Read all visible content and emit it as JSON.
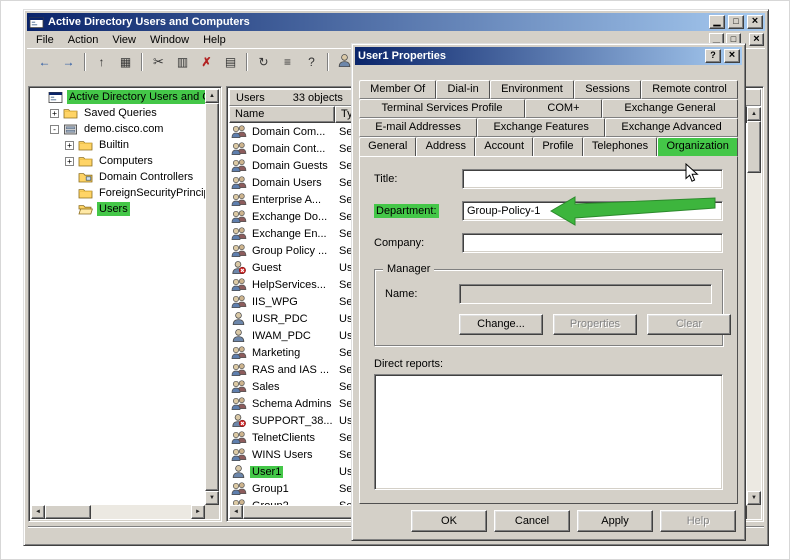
{
  "colors": {
    "titlebar_start": "#0a246a",
    "titlebar_end": "#a6caf0",
    "chrome": "#d4d0c8",
    "highlight": "#44c748",
    "annotation_green": "#3db53d"
  },
  "glyphs": {
    "minimize": "▁",
    "maximize": "□",
    "close": "×",
    "help": "?",
    "scroll_up": "▲",
    "scroll_down": "▼",
    "scroll_left": "◄",
    "scroll_right": "►"
  },
  "window": {
    "title": "Active Directory Users and Computers",
    "menu": [
      "File",
      "Action",
      "View",
      "Window",
      "Help"
    ],
    "toolbar": [
      {
        "name": "back",
        "glyph": "←"
      },
      {
        "name": "forward",
        "glyph": "→"
      },
      {
        "name": "up-one-level",
        "glyph": "↑",
        "sep_before": true
      },
      {
        "name": "show-tree",
        "glyph": "▦"
      },
      {
        "name": "cut",
        "glyph": "✂",
        "sep_before": true
      },
      {
        "name": "copy",
        "glyph": "▥"
      },
      {
        "name": "delete",
        "glyph": "✗"
      },
      {
        "name": "properties",
        "glyph": "▤"
      },
      {
        "name": "refresh",
        "glyph": "↻",
        "sep_before": true
      },
      {
        "name": "export-list",
        "glyph": "≡"
      },
      {
        "name": "help",
        "glyph": "?"
      },
      {
        "name": "add-user",
        "glyph": "user",
        "sep_before": true
      },
      {
        "name": "add-group",
        "glyph": "group"
      }
    ],
    "status_bar": ""
  },
  "tree": {
    "items": [
      {
        "label": "Active Directory Users and Computer",
        "icon": "console",
        "indent": 0,
        "toggle": "",
        "highlighted": true
      },
      {
        "label": "Saved Queries",
        "icon": "folder",
        "indent": 1,
        "toggle": "+"
      },
      {
        "label": "demo.cisco.com",
        "icon": "domain",
        "indent": 1,
        "toggle": "-"
      },
      {
        "label": "Builtin",
        "icon": "folder",
        "indent": 2,
        "toggle": "+"
      },
      {
        "label": "Computers",
        "icon": "folder",
        "indent": 2,
        "toggle": "+"
      },
      {
        "label": "Domain Controllers",
        "icon": "folder-dc",
        "indent": 2,
        "toggle": ""
      },
      {
        "label": "ForeignSecurityPrincipals",
        "icon": "folder",
        "indent": 2,
        "toggle": ""
      },
      {
        "label": "Users",
        "icon": "folder-open",
        "indent": 2,
        "toggle": "",
        "highlighted": true
      }
    ]
  },
  "list": {
    "container_label": "Users",
    "object_count": "33 objects",
    "columns": [
      "Name",
      "Typ"
    ],
    "rows": [
      {
        "name": "Domain Com...",
        "type": "Sec",
        "icon": "group"
      },
      {
        "name": "Domain Cont...",
        "type": "Sec",
        "icon": "group"
      },
      {
        "name": "Domain Guests",
        "type": "Sec",
        "icon": "group"
      },
      {
        "name": "Domain Users",
        "type": "Sec",
        "icon": "group"
      },
      {
        "name": "Enterprise A...",
        "type": "Sec",
        "icon": "group"
      },
      {
        "name": "Exchange Do...",
        "type": "Sec",
        "icon": "group"
      },
      {
        "name": "Exchange En...",
        "type": "Sec",
        "icon": "group"
      },
      {
        "name": "Group Policy ...",
        "type": "Sec",
        "icon": "group"
      },
      {
        "name": "Guest",
        "type": "Use",
        "icon": "user-disabled"
      },
      {
        "name": "HelpServices...",
        "type": "Sec",
        "icon": "group"
      },
      {
        "name": "IIS_WPG",
        "type": "Sec",
        "icon": "group"
      },
      {
        "name": "IUSR_PDC",
        "type": "Use",
        "icon": "user"
      },
      {
        "name": "IWAM_PDC",
        "type": "Use",
        "icon": "user"
      },
      {
        "name": "Marketing",
        "type": "Sec",
        "icon": "group"
      },
      {
        "name": "RAS and IAS ...",
        "type": "Sec",
        "icon": "group"
      },
      {
        "name": "Sales",
        "type": "Sec",
        "icon": "group"
      },
      {
        "name": "Schema Admins",
        "type": "Sec",
        "icon": "group"
      },
      {
        "name": "SUPPORT_38...",
        "type": "Use",
        "icon": "user-disabled"
      },
      {
        "name": "TelnetClients",
        "type": "Sec",
        "icon": "group"
      },
      {
        "name": "WINS Users",
        "type": "Sec",
        "icon": "group"
      },
      {
        "name": "User1",
        "type": "Use",
        "icon": "user",
        "highlighted": true
      },
      {
        "name": "Group1",
        "type": "Sec",
        "icon": "group"
      },
      {
        "name": "Group2",
        "type": "Sec",
        "icon": "group"
      }
    ]
  },
  "dialog": {
    "title": "User1 Properties",
    "tab_rows": [
      [
        "Member Of",
        "Dial-in",
        "Environment",
        "Sessions",
        "Remote control"
      ],
      [
        "Terminal Services Profile",
        "COM+",
        "Exchange General"
      ],
      [
        "E-mail Addresses",
        "Exchange Features",
        "Exchange Advanced"
      ],
      [
        "General",
        "Address",
        "Account",
        "Profile",
        "Telephones",
        "Organization"
      ]
    ],
    "active_tab": "Organization",
    "fields": {
      "title_label": "Title:",
      "title_value": "",
      "department_label": "Department:",
      "department_value": "Group-Policy-1",
      "company_label": "Company:",
      "company_value": ""
    },
    "manager": {
      "group_label": "Manager",
      "name_label": "Name:",
      "name_value": "",
      "buttons": [
        {
          "label": "Change...",
          "enabled": true
        },
        {
          "label": "Properties",
          "enabled": false
        },
        {
          "label": "Clear",
          "enabled": false
        }
      ]
    },
    "direct_reports_label": "Direct reports:",
    "buttons": [
      {
        "label": "OK",
        "enabled": true
      },
      {
        "label": "Cancel",
        "enabled": true
      },
      {
        "label": "Apply",
        "enabled": true
      },
      {
        "label": "Help",
        "enabled": false
      }
    ]
  }
}
